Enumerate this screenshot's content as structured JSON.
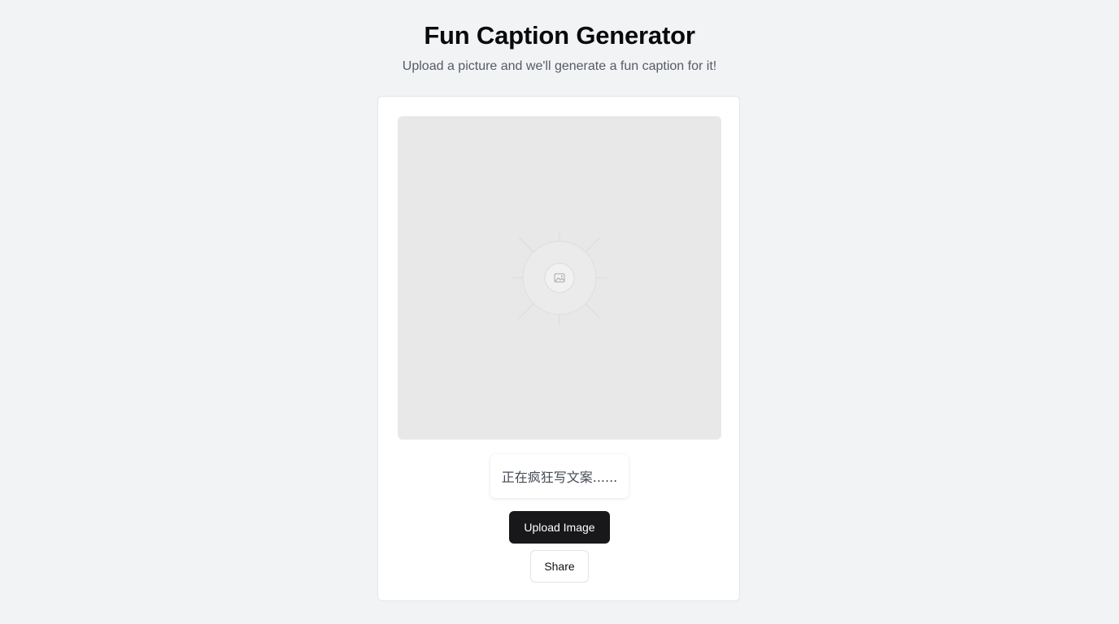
{
  "header": {
    "title": "Fun Caption Generator",
    "subtitle": "Upload a picture and we'll generate a fun caption for it!"
  },
  "card": {
    "image_placeholder_icon": "image-icon",
    "caption_status": "正在疯狂写文案......",
    "upload_button_label": "Upload Image",
    "share_button_label": "Share"
  },
  "colors": {
    "background": "#f2f3f5",
    "card": "#ffffff",
    "image_area": "#e8e8e8",
    "primary_button": "#18181a"
  }
}
